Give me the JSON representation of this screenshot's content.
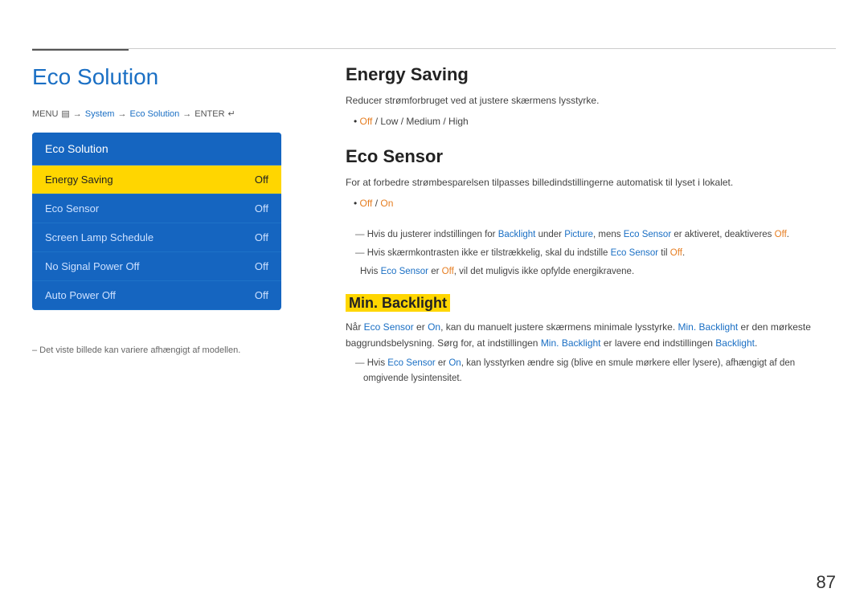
{
  "header": {
    "top_line": true,
    "accent_line": true
  },
  "page": {
    "title": "Eco Solution",
    "number": "87"
  },
  "breadcrumb": {
    "menu_label": "MENU",
    "menu_icon": "≡",
    "arrow1": "→",
    "system": "System",
    "arrow2": "→",
    "eco_solution": "Eco Solution",
    "arrow3": "→",
    "enter": "ENTER",
    "enter_icon": "↵"
  },
  "menu": {
    "title": "Eco Solution",
    "items": [
      {
        "label": "Energy Saving",
        "value": "Off",
        "active": true
      },
      {
        "label": "Eco Sensor",
        "value": "Off",
        "active": false
      },
      {
        "label": "Screen Lamp Schedule",
        "value": "Off",
        "active": false
      },
      {
        "label": "No Signal Power Off",
        "value": "Off",
        "active": false
      },
      {
        "label": "Auto Power Off",
        "value": "Off",
        "active": false
      }
    ]
  },
  "footnote": "– Det viste billede kan variere afhængigt af modellen.",
  "sections": [
    {
      "id": "energy-saving",
      "title": "Energy Saving",
      "desc": "Reducer strømforbruget ved at justere skærmens lysstyrke.",
      "bullets": [
        "Off / Low / Medium / High"
      ]
    },
    {
      "id": "eco-sensor",
      "title": "Eco Sensor",
      "desc": "For at forbedre strømbesparelsen tilpasses billedindstillingerne automatisk til lyset i lokalet.",
      "bullets": [
        "Off / On"
      ],
      "notes": [
        {
          "text_parts": [
            {
              "text": "Hvis du justerer indstillingen for ",
              "style": "normal"
            },
            {
              "text": "Backlight",
              "style": "blue"
            },
            {
              "text": " under ",
              "style": "normal"
            },
            {
              "text": "Picture",
              "style": "blue"
            },
            {
              "text": ", mens ",
              "style": "normal"
            },
            {
              "text": "Eco Sensor",
              "style": "blue"
            },
            {
              "text": " er aktiveret, deaktiveres ",
              "style": "normal"
            },
            {
              "text": "Off",
              "style": "orange"
            },
            {
              "text": ".",
              "style": "normal"
            }
          ]
        },
        {
          "text_parts": [
            {
              "text": "Hvis skærmkontrasten ikke er tilstrækkelig, skal du indstille ",
              "style": "normal"
            },
            {
              "text": "Eco Sensor",
              "style": "blue"
            },
            {
              "text": " til ",
              "style": "normal"
            },
            {
              "text": "Off",
              "style": "orange"
            },
            {
              "text": ".",
              "style": "normal"
            }
          ],
          "sub": "Hvis Eco Sensor er Off, vil det muligvis ikke opfylde energikravene."
        }
      ]
    },
    {
      "id": "min-backlight",
      "title": "Min. Backlight",
      "title_style": "yellow-bg",
      "desc1": "Når Eco Sensor er On, kan du manuelt justere skærmens minimale lysstyrke. Min. Backlight er den mørkeste baggrundsbelysning. Sørg for, at indstillingen Min. Backlight er lavere end indstillingen Backlight.",
      "notes": [
        {
          "text_parts": [
            {
              "text": "Hvis ",
              "style": "normal"
            },
            {
              "text": "Eco Sensor",
              "style": "blue"
            },
            {
              "text": " er ",
              "style": "normal"
            },
            {
              "text": "On",
              "style": "blue"
            },
            {
              "text": ", kan lysstyrken ændre sig (blive en smule mørkere eller lysere), afhængigt af den omgivende lysintensitet.",
              "style": "normal"
            }
          ]
        }
      ]
    }
  ]
}
